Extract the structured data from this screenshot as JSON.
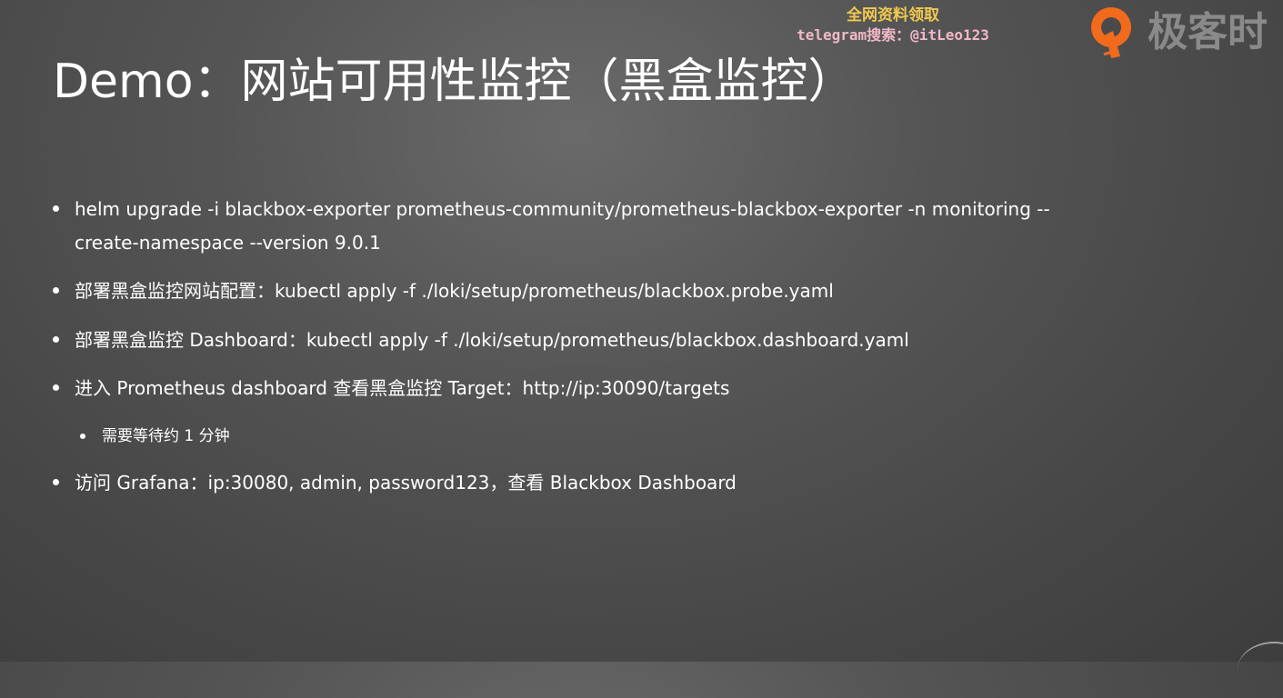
{
  "slide": {
    "title": "Demo：网站可用性监控（黑盒监控）"
  },
  "watermark": {
    "line1": "全网资料领取",
    "line2": "telegram搜索：@itLeo123"
  },
  "brand": {
    "name": "极客时",
    "icon": "geektime-logo-icon",
    "accent_color": "#f26b1d"
  },
  "bullets": [
    {
      "text": "helm upgrade -i blackbox-exporter prometheus-community/prometheus-blackbox-exporter -n monitoring --create-namespace --version 9.0.1"
    },
    {
      "text": "部署黑盒监控网站配置：kubectl apply -f ./loki/setup/prometheus/blackbox.probe.yaml"
    },
    {
      "text": "部署黑盒监控 Dashboard：kubectl apply -f ./loki/setup/prometheus/blackbox.dashboard.yaml"
    },
    {
      "text": "进入 Prometheus dashboard 查看黑盒监控 Target：http://ip:30090/targets"
    },
    {
      "text": "访问 Grafana：ip:30080, admin, password123，查看 Blackbox Dashboard"
    }
  ],
  "sub_bullets": [
    {
      "text": "需要等待约 1 分钟"
    }
  ]
}
